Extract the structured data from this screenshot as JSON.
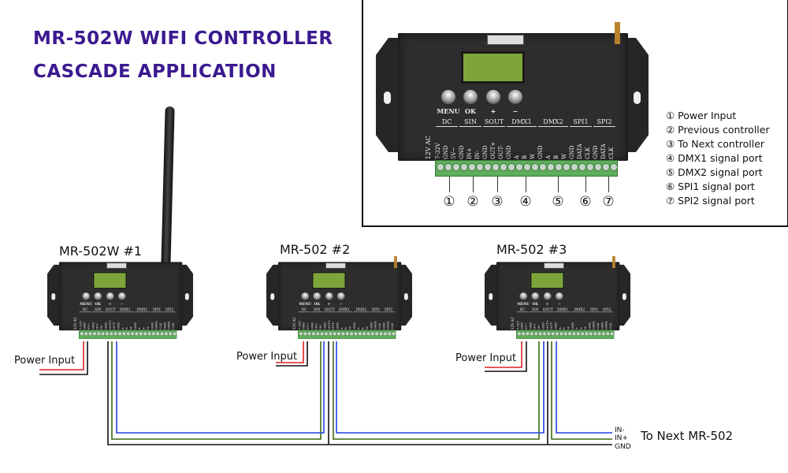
{
  "title": {
    "line1": "MR-502W WIFI CONTROLLER",
    "line2": "CASCADE APPLICATION",
    "color": "#3b1a8f"
  },
  "device": {
    "buttons": [
      "MENU",
      "OK",
      "+",
      "−"
    ],
    "ac_label": "12V AC",
    "groups": [
      {
        "name": "DC",
        "pins": [
          "7-32V",
          "GND",
          "5V~"
        ]
      },
      {
        "name": "SIN",
        "pins": [
          "GND",
          "IN+",
          "IN-"
        ]
      },
      {
        "name": "SOUT",
        "pins": [
          "GND",
          "OUT+",
          "OUT-"
        ]
      },
      {
        "name": "DMX1",
        "pins": [
          "GND",
          "A",
          "B",
          "W"
        ]
      },
      {
        "name": "DMX2",
        "pins": [
          "GND",
          "A",
          "B",
          "W"
        ]
      },
      {
        "name": "SPI1",
        "pins": [
          "GND",
          "DATA",
          "CLK"
        ]
      },
      {
        "name": "SPI2",
        "pins": [
          "GND",
          "DATA",
          "CLK"
        ]
      }
    ]
  },
  "port_numbers": [
    "①",
    "②",
    "③",
    "④",
    "⑤",
    "⑥",
    "⑦"
  ],
  "legend": [
    "① Power Input",
    "② Previous controller",
    "③ To Next controller",
    "④ DMX1 signal port",
    "⑤ DMX2 signal port",
    "⑥ SPI1 signal port",
    "⑦ SPI2 signal port"
  ],
  "controllers": [
    {
      "label": "MR-502W  #1",
      "power_label": "Power Input"
    },
    {
      "label": "MR-502 #2",
      "power_label": "Power Input"
    },
    {
      "label": "MR-502 #3",
      "power_label": "Power Input"
    }
  ],
  "wire_labels": {
    "in_minus": "IN-",
    "in_plus": "IN+",
    "gnd": "GND",
    "next": "To Next MR-502"
  },
  "wire_colors": {
    "power_positive": "#e02020",
    "ground": "#111111",
    "in_plus": "#3a6a10",
    "in_minus": "#2040e0"
  }
}
